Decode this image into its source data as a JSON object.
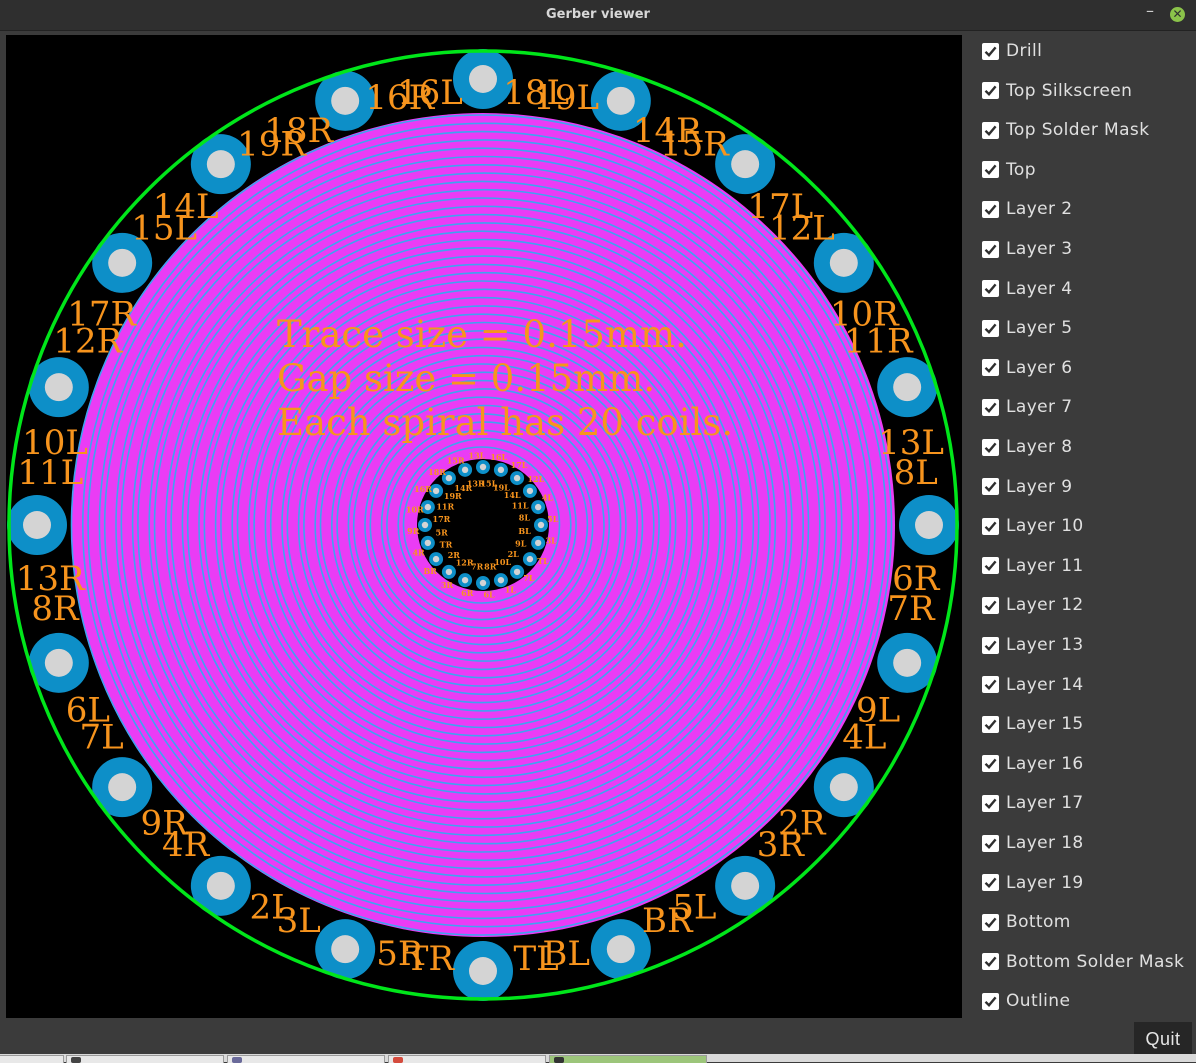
{
  "window": {
    "title": "Gerber viewer",
    "minimize_symbol": "–",
    "close_symbol": "✕"
  },
  "viewer": {
    "notes": [
      "Trace size = 0.15mm.",
      "Gap size = 0.15mm.",
      "Each spiral has 20 coils."
    ],
    "outer_pad_labels": [
      "16L",
      "18L",
      "19L",
      "14R",
      "15R",
      "17L",
      "12L",
      "10R",
      "11R",
      "13L",
      "8L",
      "6R",
      "7R",
      "9L",
      "4L",
      "2R",
      "3R",
      "5L",
      "BR",
      "BL",
      "TL",
      "TR",
      "5R",
      "3L",
      "2L",
      "4R",
      "9R",
      "7L",
      "6L",
      "8R",
      "13R",
      "11L",
      "10L",
      "12R",
      "17R",
      "15L",
      "14L",
      "19R",
      "18R",
      "16R"
    ],
    "inner_pad_labels": [
      "13L",
      "15L",
      "16L",
      "19L",
      "17L",
      "14L",
      "12L",
      "11L",
      "4L",
      "8L",
      "5L",
      "BL",
      "3L",
      "9L",
      "TL",
      "2L",
      "7L",
      "10L",
      "1L",
      "8R",
      "6L",
      "7R",
      "6R",
      "12R",
      "3R",
      "2R",
      "BR",
      "TR",
      "4R",
      "5R",
      "9R",
      "17R",
      "10R",
      "11R",
      "16R",
      "19R",
      "18R",
      "14R",
      "15R",
      "13R"
    ],
    "coil_count": 20,
    "colors": {
      "coil": "#ea3cf5",
      "coil_edge": "#3fa3f0",
      "pad": "#0d8fc8",
      "drill": "#d4d4d4",
      "outline": "#00e61a",
      "silkscreen": "#f7941d",
      "background": "#000000"
    }
  },
  "layers": [
    {
      "label": "Drill",
      "checked": true
    },
    {
      "label": "Top Silkscreen",
      "checked": true
    },
    {
      "label": "Top Solder Mask",
      "checked": true
    },
    {
      "label": "Top",
      "checked": true
    },
    {
      "label": "Layer 2",
      "checked": true
    },
    {
      "label": "Layer 3",
      "checked": true
    },
    {
      "label": "Layer 4",
      "checked": true
    },
    {
      "label": "Layer 5",
      "checked": true
    },
    {
      "label": "Layer 6",
      "checked": true
    },
    {
      "label": "Layer 7",
      "checked": true
    },
    {
      "label": "Layer 8",
      "checked": true
    },
    {
      "label": "Layer 9",
      "checked": true
    },
    {
      "label": "Layer 10",
      "checked": true
    },
    {
      "label": "Layer 11",
      "checked": true
    },
    {
      "label": "Layer 12",
      "checked": true
    },
    {
      "label": "Layer 13",
      "checked": true
    },
    {
      "label": "Layer 14",
      "checked": true
    },
    {
      "label": "Layer 15",
      "checked": true
    },
    {
      "label": "Layer 16",
      "checked": true
    },
    {
      "label": "Layer 17",
      "checked": true
    },
    {
      "label": "Layer 18",
      "checked": true
    },
    {
      "label": "Layer 19",
      "checked": true
    },
    {
      "label": "Bottom",
      "checked": true
    },
    {
      "label": "Bottom Solder Mask",
      "checked": true
    },
    {
      "label": "Outline",
      "checked": true
    }
  ],
  "quit_label": "Quit"
}
